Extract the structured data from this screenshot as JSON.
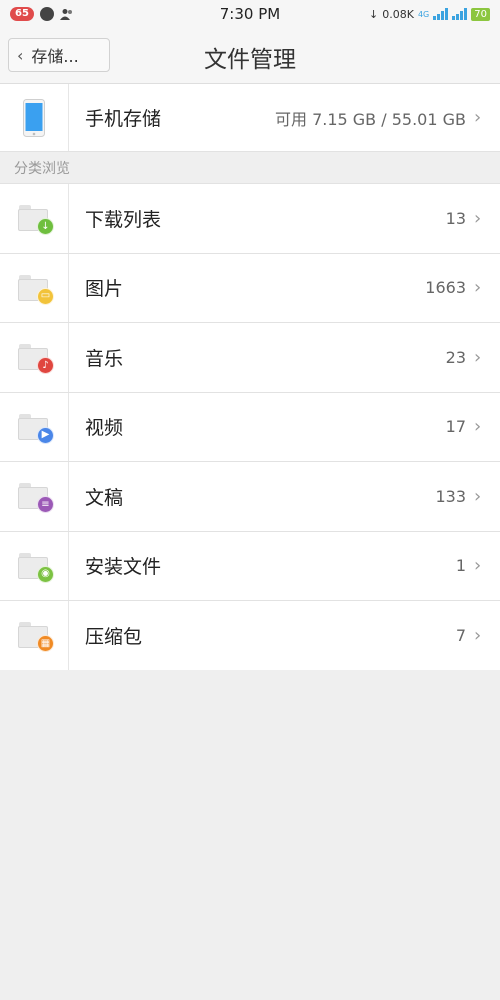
{
  "status_bar": {
    "notification_count": "65",
    "time": "7:30 PM",
    "network_speed": "0.08K",
    "network_type": "4G",
    "battery": "70"
  },
  "header": {
    "back_label": "存储...",
    "title": "文件管理"
  },
  "storage": {
    "label": "手机存储",
    "value": "可用 7.15 GB / 55.01 GB"
  },
  "section": {
    "title": "分类浏览"
  },
  "categories": [
    {
      "label": "下载列表",
      "count": "13",
      "icon": "download-icon",
      "color": "#6fbf3f",
      "glyph": "↓"
    },
    {
      "label": "图片",
      "count": "1663",
      "icon": "image-icon",
      "color": "#f2c33a",
      "glyph": "▭"
    },
    {
      "label": "音乐",
      "count": "23",
      "icon": "music-icon",
      "color": "#e0463f",
      "glyph": "♪"
    },
    {
      "label": "视频",
      "count": "17",
      "icon": "video-icon",
      "color": "#4a86e8",
      "glyph": "▶"
    },
    {
      "label": "文稿",
      "count": "133",
      "icon": "document-icon",
      "color": "#9b59b6",
      "glyph": "≡"
    },
    {
      "label": "安装文件",
      "count": "1",
      "icon": "android-icon",
      "color": "#7cc242",
      "glyph": "◉"
    },
    {
      "label": "压缩包",
      "count": "7",
      "icon": "archive-icon",
      "color": "#f08a24",
      "glyph": "▦"
    }
  ],
  "colors": {
    "accent_phone": "#3aa0f0"
  }
}
